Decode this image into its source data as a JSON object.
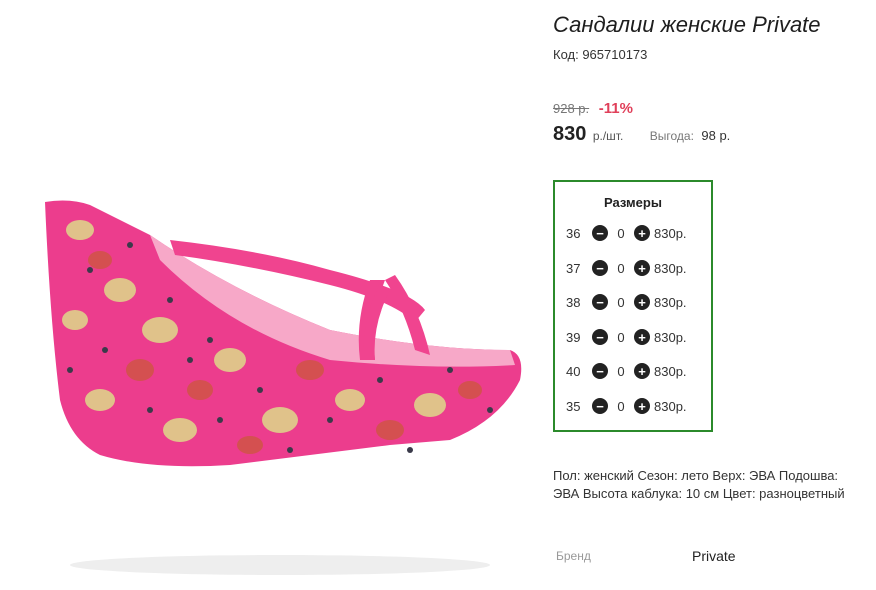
{
  "product": {
    "title": "Сандалии женские Private",
    "code": "Код: 965710173",
    "old_price": "928 р.",
    "discount": "-11%",
    "price": "830",
    "price_unit": "р./шт.",
    "benefit_label": "Выгода:",
    "benefit_value": "98 р."
  },
  "sizes": {
    "title": "Размеры",
    "rows": [
      {
        "size": "36",
        "qty": "0",
        "price": "830р."
      },
      {
        "size": "37",
        "qty": "0",
        "price": "830р."
      },
      {
        "size": "38",
        "qty": "0",
        "price": "830р."
      },
      {
        "size": "39",
        "qty": "0",
        "price": "830р."
      },
      {
        "size": "40",
        "qty": "0",
        "price": "830р."
      },
      {
        "size": "35",
        "qty": "0",
        "price": "830р."
      }
    ],
    "minus_icon": "minus-circle-icon",
    "plus_icon": "plus-circle-icon",
    "border_color": "#2b8a2b"
  },
  "description": "Пол: женский Сезон: лето Верх: ЭВА Подошва: ЭВА Высота каблука: 10 см Цвет: разноцветный",
  "brand": {
    "label": "Бренд",
    "value": "Private"
  },
  "colors": {
    "discount": "#e0405a",
    "shoe_pink": "#ec3d8d"
  }
}
